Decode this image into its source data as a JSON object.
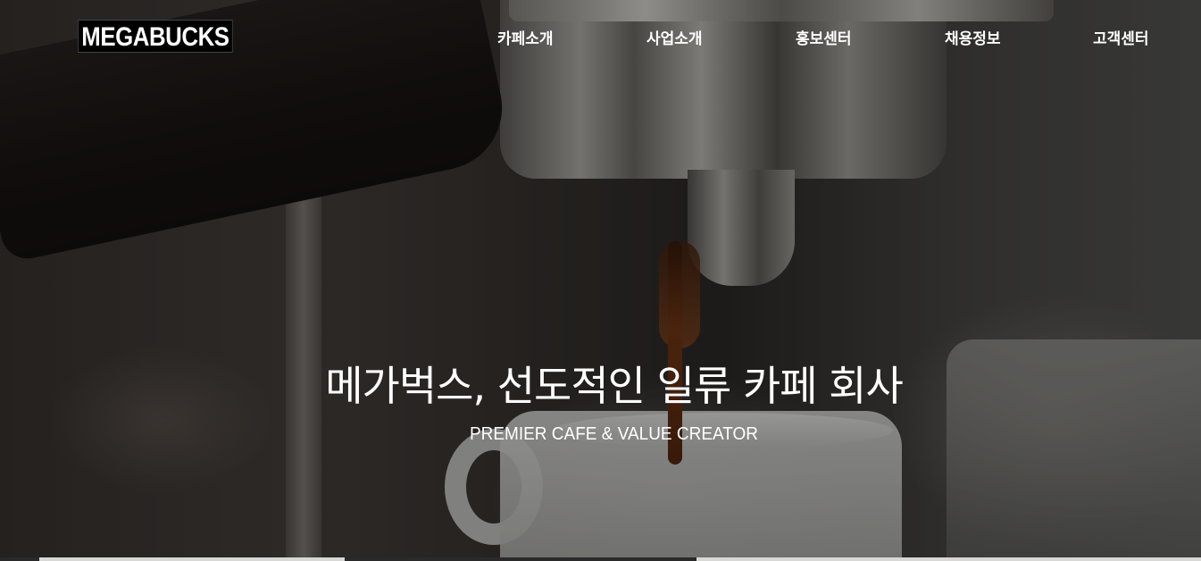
{
  "header": {
    "logo": "MEGABUCKS",
    "nav": [
      {
        "label": "카페소개"
      },
      {
        "label": "사업소개"
      },
      {
        "label": "홍보센터"
      },
      {
        "label": "채용정보"
      },
      {
        "label": "고객센터"
      }
    ]
  },
  "hero": {
    "title": "메가벅스, 선도적인 일류 카페 회사",
    "subtitle": "PREMIER CAFE & VALUE CREATOR",
    "image_subject": "espresso pouring from a portafilter into a white cup"
  }
}
